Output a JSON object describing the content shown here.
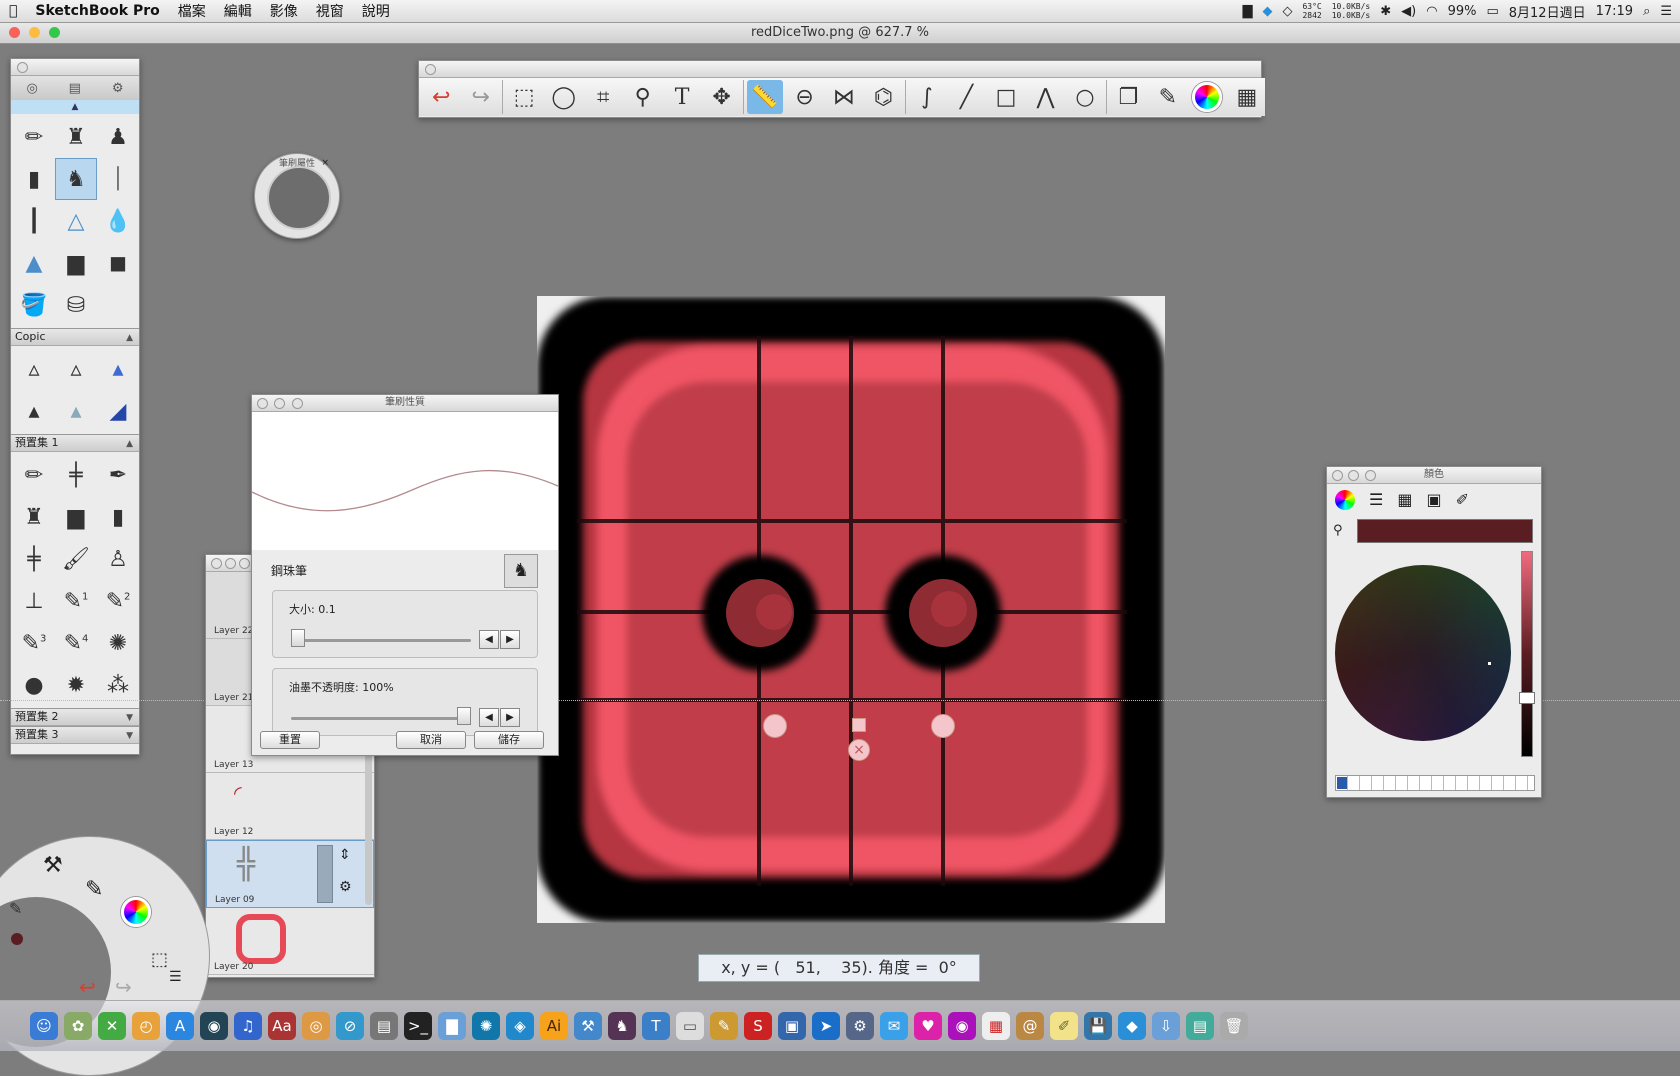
{
  "menubar": {
    "apple": "",
    "app_name": "SketchBook Pro",
    "items": [
      "檔案",
      "編輯",
      "影像",
      "視窗",
      "說明"
    ],
    "status": {
      "temp": "63°C",
      "fan": "2842",
      "net_up": "10.0KB/s",
      "net_down": "10.0KB/s",
      "battery": "99%",
      "date": "8月12日週日",
      "time": "17:19"
    }
  },
  "window": {
    "title": "redDiceTwo.png @ 627.7 %"
  },
  "toolbar": {
    "tools": [
      "undo-icon",
      "redo-icon",
      "select-rect-icon",
      "lasso-icon",
      "crop-icon",
      "zoom-icon",
      "text-icon",
      "move-icon",
      "ruler-icon",
      "ellipse-guide-icon",
      "symmetry-icon",
      "mirror-icon",
      "curve-icon",
      "line-icon",
      "rect-icon",
      "polyline-icon",
      "ellipse-icon",
      "layers-icon",
      "brushes-icon",
      "color-wheel-icon",
      "palette-grid-icon"
    ]
  },
  "palette": {
    "sections": [
      "Copic",
      "預置集 1",
      "預置集 2",
      "預置集 3"
    ],
    "number_badges": [
      "1",
      "2",
      "3",
      "4"
    ]
  },
  "brush_puck": {
    "label": "筆刷屬性"
  },
  "brush_properties": {
    "title": "筆刷性質",
    "brush_name": "鋼珠筆",
    "size_label": "大小: 0.1",
    "opacity_label": "油墨不透明度: 100%",
    "reset": "重置",
    "cancel": "取消",
    "save": "儲存"
  },
  "layers": {
    "items": [
      "Layer 22",
      "Layer 21",
      "Layer 13",
      "Layer 12",
      "Layer 09",
      "Layer 20"
    ]
  },
  "colors": {
    "title": "顏色",
    "current_color": "#5a1d22"
  },
  "status": {
    "readout": "x, y = (   51,    35). 角度 =  0°"
  },
  "accent": "#e25a66"
}
